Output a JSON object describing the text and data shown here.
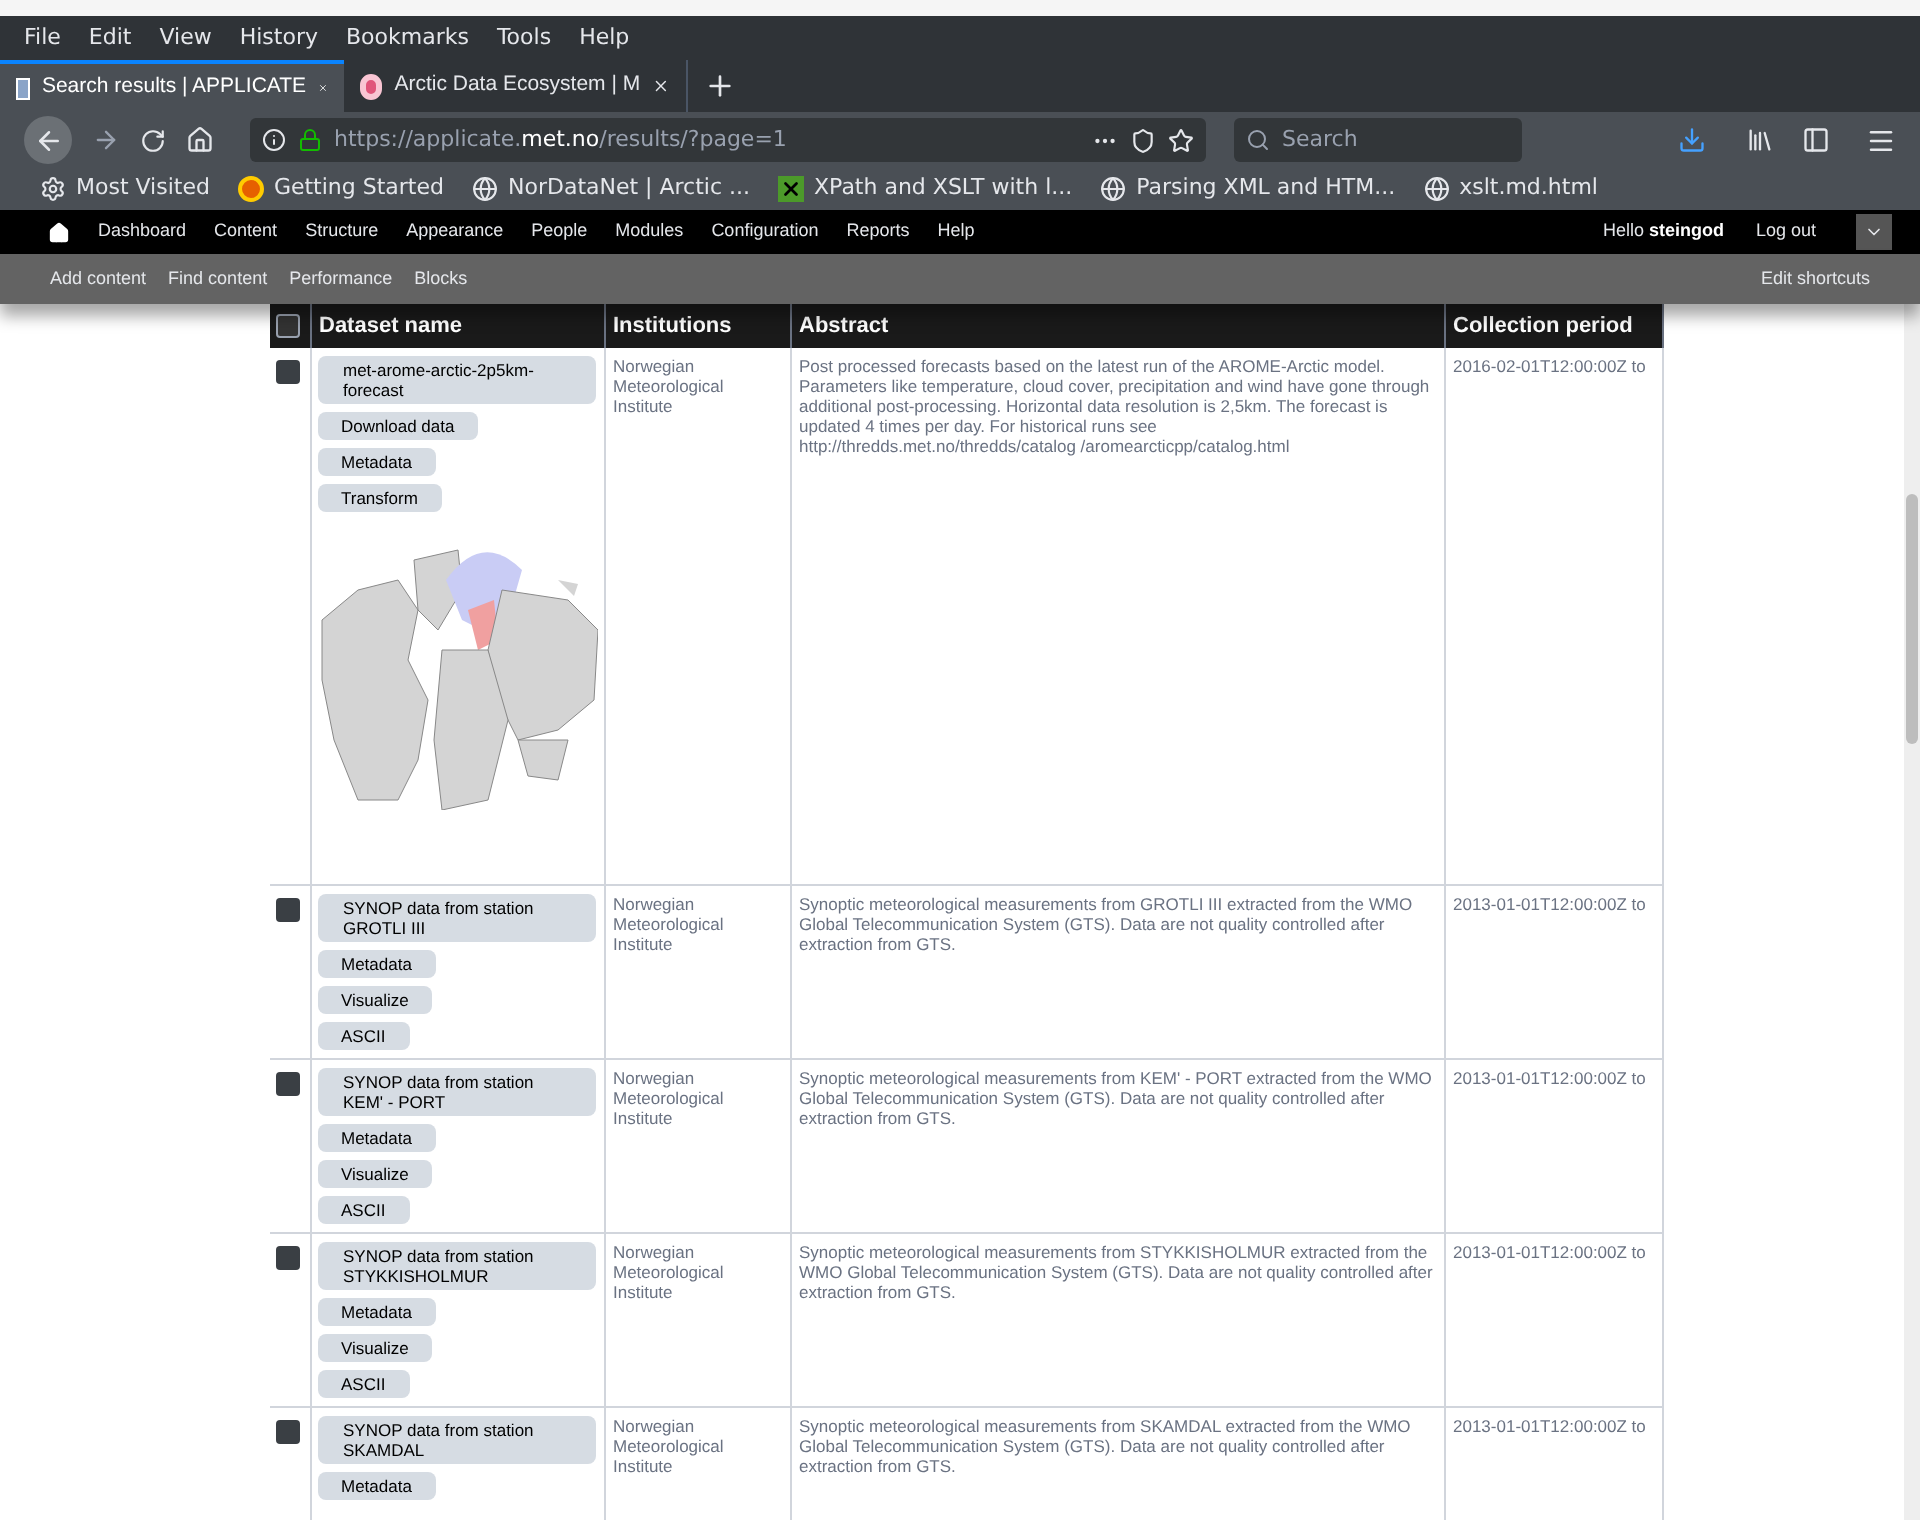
{
  "menu": [
    "File",
    "Edit",
    "View",
    "History",
    "Bookmarks",
    "Tools",
    "Help"
  ],
  "tabs": [
    {
      "title": "Search results | APPLICATE",
      "selected": true,
      "kind": "page"
    },
    {
      "title": "Arctic Data Ecosystem | M",
      "selected": false,
      "kind": "circle"
    }
  ],
  "address": {
    "url_prefix": "https://applicate.",
    "url_domain": "met.no",
    "url_path": "/results/?page=1"
  },
  "search": {
    "placeholder": "Search"
  },
  "bookmarks": [
    {
      "label": "Most Visited",
      "kind": "gear"
    },
    {
      "label": "Getting Started",
      "kind": "fox"
    },
    {
      "label": "NorDataNet | Arctic ...",
      "kind": "globe"
    },
    {
      "label": "XPath and XSLT with l...",
      "kind": "x"
    },
    {
      "label": "Parsing XML and HTM...",
      "kind": "globe"
    },
    {
      "label": "xslt.md.html",
      "kind": "globe"
    }
  ],
  "admin_toolbar": {
    "items": [
      "Dashboard",
      "Content",
      "Structure",
      "Appearance",
      "People",
      "Modules",
      "Configuration",
      "Reports",
      "Help"
    ],
    "greeting": "Hello **steingod**",
    "logout": "Log out"
  },
  "shortcuts": {
    "items": [
      "Add content",
      "Find content",
      "Performance",
      "Blocks"
    ],
    "edit": "Edit shortcuts"
  },
  "table": {
    "select_all_checked": false,
    "columns": [
      "Dataset name",
      "Institutions",
      "Abstract",
      "Collection period"
    ],
    "rows": [
      {
        "checked": false,
        "name": "met-arome-arctic-2p5km-forecast",
        "actions": [
          "Download data",
          "Metadata",
          "Transform"
        ],
        "preview": {
          "kind": "picture"
        },
        "institution": "Norwegian Meteorological Institute",
        "abstract": "Post processed forecasts based on the latest run of the AROME-Arctic model. Parameters like temperature, cloud cover, precipitation and wind have gone through additional post-processing. Horizontal data resolution is 2,5km. The forecast is updated 4 times per day. For historical runs see http://thredds.met.no/thredds/catalog /aromearcticpp/catalog.html",
        "period": "2016-02-01T12:00:00Z to"
      },
      {
        "checked": false,
        "name": "SYNOP data from station GROTLI III",
        "actions": [
          "Metadata",
          "Visualize",
          "ASCII"
        ],
        "institution": "Norwegian Meteorological Institute",
        "abstract": "Synoptic meteorological measurements from GROTLI III extracted from the WMO Global Telecommunication System (GTS). Data are not quality controlled after extraction from GTS.",
        "period": "2013-01-01T12:00:00Z to"
      },
      {
        "checked": false,
        "name": "SYNOP data from station KEM' - PORT",
        "actions": [
          "Metadata",
          "Visualize",
          "ASCII"
        ],
        "institution": "Norwegian Meteorological Institute",
        "abstract": "Synoptic meteorological measurements from KEM' - PORT extracted from the WMO Global Telecommunication System (GTS). Data are not quality controlled after extraction from GTS.",
        "period": "2013-01-01T12:00:00Z to"
      },
      {
        "checked": false,
        "name": "SYNOP data from station STYKKISHOLMUR",
        "actions": [
          "Metadata",
          "Visualize",
          "ASCII"
        ],
        "institution": "Norwegian Meteorological Institute",
        "abstract": "Synoptic meteorological measurements from STYKKISHOLMUR extracted from the WMO Global Telecommunication System (GTS). Data are not quality controlled after extraction from GTS.",
        "period": "2013-01-01T12:00:00Z to"
      },
      {
        "checked": false,
        "name": "SYNOP data from station SKAMDAL",
        "actions": [
          "Metadata"
        ],
        "institution": "Norwegian Meteorological Institute",
        "abstract": "Synoptic meteorological measurements from SKAMDAL extracted from the WMO Global Telecommunication System (GTS). Data are not quality controlled after extraction from GTS.",
        "period": "2013-01-01T12:00:00Z to"
      }
    ]
  }
}
